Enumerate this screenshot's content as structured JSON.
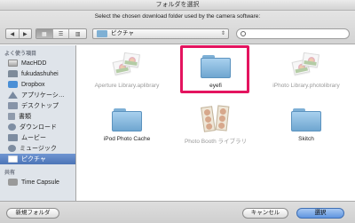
{
  "window": {
    "title": "フォルダを選択"
  },
  "header": {
    "prompt": "Select the chosen download folder used by the camera software:",
    "nav_back": "◀",
    "nav_forward": "▶",
    "view_icon_label": "▦",
    "view_list_label": "☰",
    "view_column_label": "▥",
    "location": "ピクチャ",
    "search_placeholder": ""
  },
  "sidebar": {
    "sections": [
      {
        "title": "よく使う項目",
        "items": [
          {
            "label": "MacHDD",
            "icon": "hard-disk-icon"
          },
          {
            "label": "fukudashuhei",
            "icon": "home-icon"
          },
          {
            "label": "Dropbox",
            "icon": "dropbox-icon"
          },
          {
            "label": "アプリケーシ…",
            "icon": "applications-icon"
          },
          {
            "label": "デスクトップ",
            "icon": "desktop-icon"
          },
          {
            "label": "書類",
            "icon": "documents-icon"
          },
          {
            "label": "ダウンロード",
            "icon": "downloads-icon"
          },
          {
            "label": "ムービー",
            "icon": "movies-icon"
          },
          {
            "label": "ミュージック",
            "icon": "music-icon"
          },
          {
            "label": "ピクチャ",
            "icon": "pictures-icon",
            "selected": true
          }
        ]
      },
      {
        "title": "共有",
        "items": [
          {
            "label": "Time Capsule",
            "icon": "time-capsule-icon"
          }
        ]
      }
    ]
  },
  "files": [
    {
      "name": "Aperture Library.aplibrary",
      "kind": "library",
      "dimmed": true
    },
    {
      "name": "eyefi",
      "kind": "folder",
      "highlighted": true
    },
    {
      "name": "iPhoto Library.photolibrary",
      "kind": "library",
      "dimmed": true
    },
    {
      "name": "iPod Photo Cache",
      "kind": "folder"
    },
    {
      "name": "Photo Booth ライブラリ",
      "kind": "photobooth",
      "dimmed": true
    },
    {
      "name": "Skitch",
      "kind": "folder"
    }
  ],
  "footer": {
    "new_folder_label": "新規フォルダ",
    "cancel_label": "キャンセル",
    "choose_label": "選択"
  },
  "colors": {
    "highlight": "#e4145f",
    "selection": "#5a80c2",
    "folder": "#8fc0e4",
    "primary_button": "#6a9de3"
  }
}
